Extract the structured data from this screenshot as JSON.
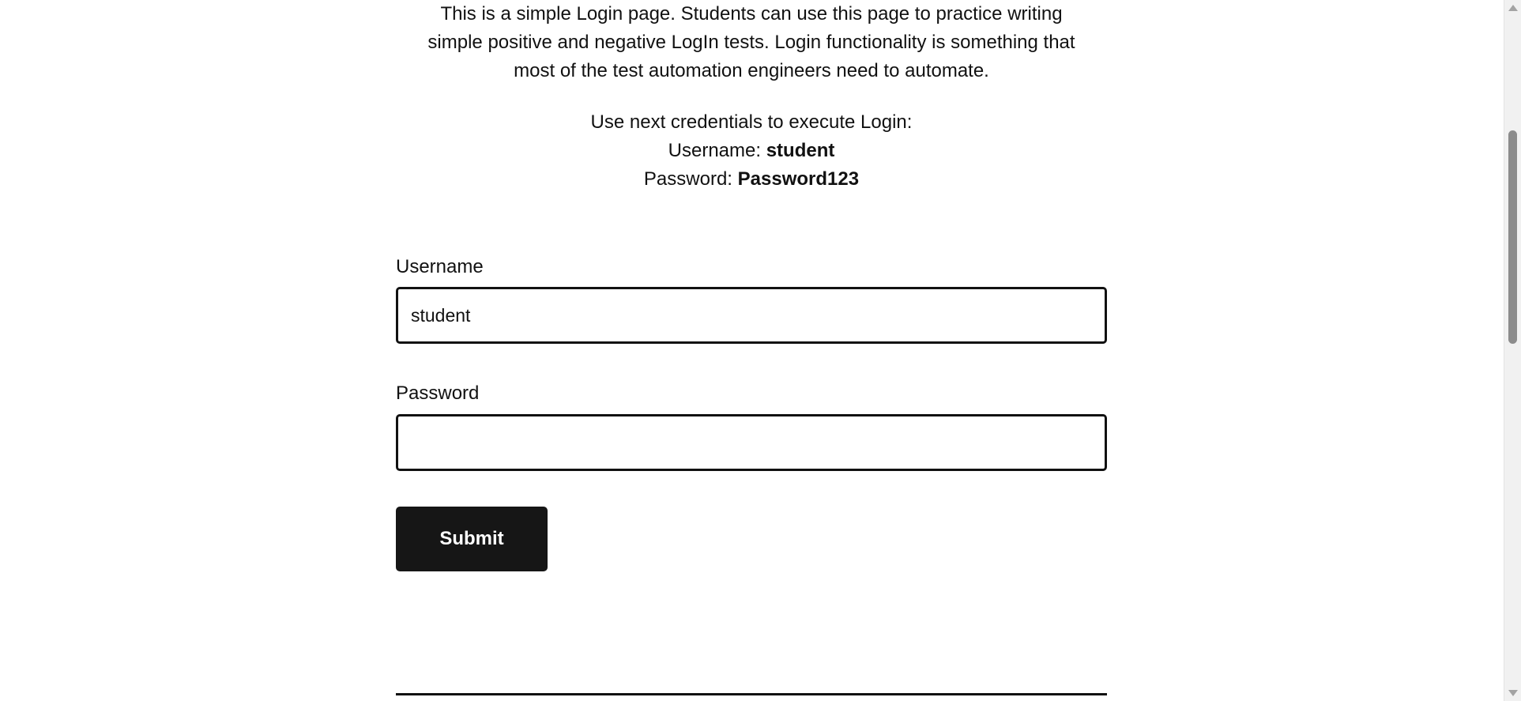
{
  "intro": {
    "text": "This is a simple Login page. Students can use this page to practice writing simple positive and negative LogIn tests. Login functionality is something that most of the test automation engineers need to automate."
  },
  "credentials": {
    "heading": "Use next credentials to execute Login:",
    "username_label": "Username:",
    "username_value": "student",
    "password_label": "Password:",
    "password_value": "Password123"
  },
  "form": {
    "username_label": "Username",
    "username_value": "student",
    "password_label": "Password",
    "password_value": "",
    "submit_label": "Submit"
  },
  "scrollbar": {
    "icons": [
      "scroll-up-arrow",
      "scroll-down-arrow"
    ]
  }
}
